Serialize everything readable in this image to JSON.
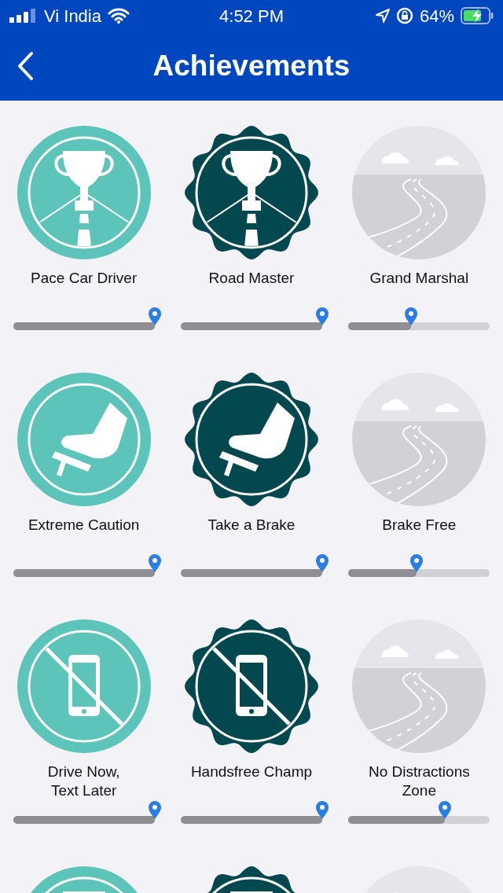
{
  "status_bar": {
    "carrier": "Vi India",
    "time": "4:52 PM",
    "battery": "64%"
  },
  "header": {
    "title": "Achievements"
  },
  "rows": [
    {
      "items": [
        {
          "kind": "earned",
          "title": "Pace Car Driver",
          "level": 1
        },
        {
          "kind": "mastered",
          "title": "Road Master",
          "level": 1
        },
        {
          "kind": "locked",
          "title": "Grand Marshal",
          "level": 0.44
        }
      ]
    },
    {
      "items": [
        {
          "kind": "earned",
          "title": "Extreme Caution",
          "level": 1
        },
        {
          "kind": "mastered",
          "title": "Take a Brake",
          "level": 1
        },
        {
          "kind": "locked",
          "title": "Brake Free",
          "level": 0.48
        }
      ]
    },
    {
      "items": [
        {
          "kind": "earned",
          "title": "Drive Now,\nText Later",
          "level": 1
        },
        {
          "kind": "mastered",
          "title": "Handsfree Champ",
          "level": 1
        },
        {
          "kind": "locked",
          "title": "No Distractions\nZone",
          "level": 0.68
        }
      ]
    },
    {
      "items": [
        {
          "kind": "earned"
        },
        {
          "kind": "mastered"
        },
        {
          "kind": "locked"
        }
      ]
    }
  ]
}
